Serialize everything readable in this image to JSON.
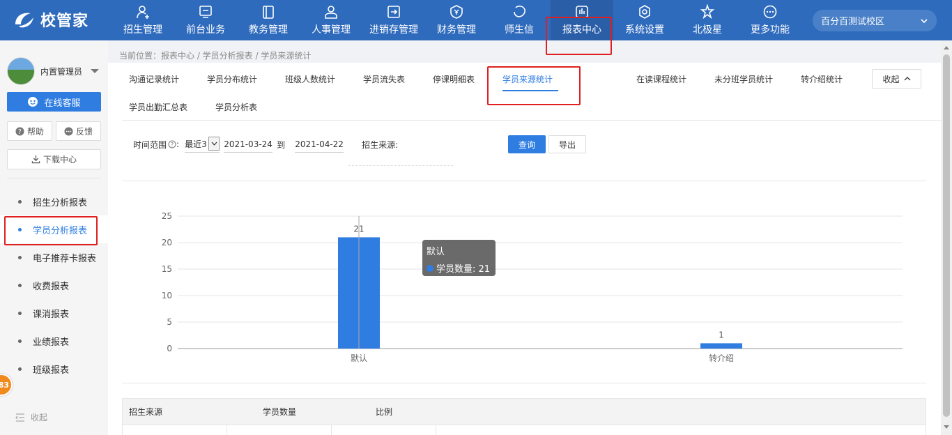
{
  "app": {
    "logo_text": "校管家"
  },
  "nav": {
    "items": [
      {
        "label": "招生管理",
        "icon": "user-add-icon"
      },
      {
        "label": "前台业务",
        "icon": "monitor-icon"
      },
      {
        "label": "教务管理",
        "icon": "book-icon"
      },
      {
        "label": "人事管理",
        "icon": "person-icon"
      },
      {
        "label": "进销存管理",
        "icon": "inventory-icon"
      },
      {
        "label": "财务管理",
        "icon": "yen-shield-icon"
      },
      {
        "label": "师生信",
        "icon": "chat-icon"
      },
      {
        "label": "报表中心",
        "icon": "report-icon"
      },
      {
        "label": "系统设置",
        "icon": "gear-icon"
      },
      {
        "label": "北极星",
        "icon": "star-icon"
      },
      {
        "label": "更多功能",
        "icon": "more-icon"
      }
    ],
    "active_index": 7,
    "campus": "百分百测试校区"
  },
  "sidebar": {
    "user_name": "内置管理员",
    "service_label": "在线客服",
    "help_label": "帮助",
    "feedback_label": "反馈",
    "download_label": "下载中心",
    "menu": [
      {
        "label": "招生分析报表"
      },
      {
        "label": "学员分析报表"
      },
      {
        "label": "电子推荐卡报表"
      },
      {
        "label": "收费报表"
      },
      {
        "label": "课消报表"
      },
      {
        "label": "业绩报表"
      },
      {
        "label": "班级报表"
      }
    ],
    "active_menu_index": 1,
    "collapse_label": "收起",
    "badge": "83"
  },
  "breadcrumb": "当前位置：报表中心 / 学员分析报表 / 学员来源统计",
  "tabs": {
    "row1": [
      "沟通记录统计",
      "学员分布统计",
      "班级人数统计",
      "学员流失表",
      "停课明细表",
      "学员来源统计",
      "在读课程统计",
      "未分班学员统计",
      "转介绍统计"
    ],
    "row2": [
      "学员出勤汇总表",
      "学员分析表"
    ],
    "active": "学员来源统计",
    "fold_label": "收起"
  },
  "filters": {
    "time_label": "时间范围",
    "range_value": "最近3",
    "start_date": "2021-03-24",
    "to_label": "到",
    "end_date": "2021-04-22",
    "source_label": "招生来源:",
    "query_label": "查询",
    "export_label": "导出"
  },
  "chart_data": {
    "type": "bar",
    "categories": [
      "默认",
      "转介绍"
    ],
    "series": [
      {
        "name": "学员数量",
        "values": [
          21,
          1
        ]
      }
    ],
    "ylim": [
      0,
      25
    ],
    "yticks": [
      0,
      5,
      10,
      15,
      20,
      25
    ],
    "grid": true,
    "color": "#2f7de1"
  },
  "tooltip": {
    "title": "默认",
    "series_label": "学员数量: 21"
  },
  "table": {
    "headers": [
      "招生来源",
      "学员数量",
      "比例"
    ]
  }
}
